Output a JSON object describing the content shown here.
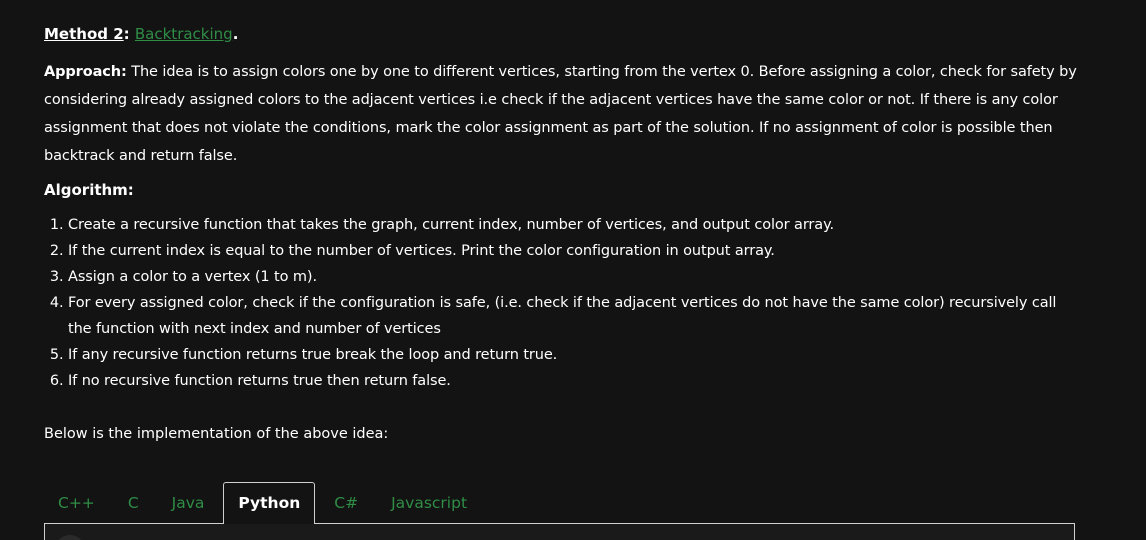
{
  "method": {
    "label": "Method 2",
    "colon": ":",
    "link_text": "Backtracking",
    "end": "."
  },
  "approach": {
    "label": "Approach:",
    "text": " The idea is to assign colors one by one to different vertices, starting from the vertex 0. Before assigning a color, check for safety by considering already assigned colors to the adjacent vertices i.e check if the adjacent vertices have the same color or not. If there is any color assignment that does not violate the conditions, mark the color assignment as part of the solution. If no assignment of color is possible then backtrack and return false."
  },
  "algorithm": {
    "title": "Algorithm:",
    "steps": [
      "Create a recursive function that takes the graph, current index, number of vertices, and output color array.",
      "If the current index is equal to the number of vertices. Print the color configuration in output array.",
      "Assign a color to a vertex (1 to m).",
      "For every assigned color, check if the configuration is safe, (i.e. check if the adjacent vertices do not have the same color) recursively call the function with next index and number of vertices",
      "If any recursive function returns true break the loop and return true.",
      "If no recursive function returns true then return false."
    ]
  },
  "below_text": "Below is the implementation of the above idea:",
  "tabs": [
    {
      "label": "C++",
      "active": false
    },
    {
      "label": "C",
      "active": false
    },
    {
      "label": "Java",
      "active": false
    },
    {
      "label": "Python",
      "active": true
    },
    {
      "label": "C#",
      "active": false
    },
    {
      "label": "Javascript",
      "active": false
    }
  ],
  "colors": {
    "background": "#131313",
    "link": "#2f8d46",
    "text": "#ffffff"
  }
}
